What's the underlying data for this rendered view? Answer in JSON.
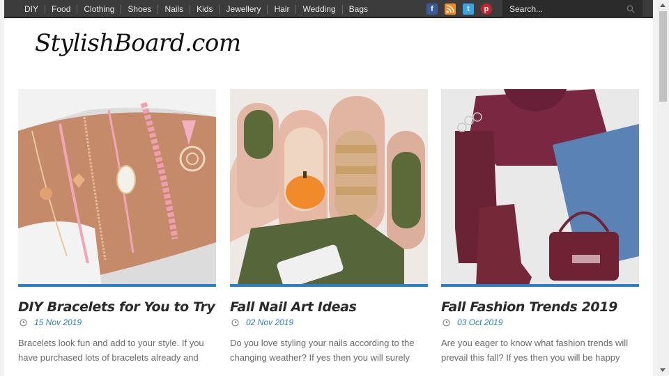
{
  "nav": {
    "items": [
      "DIY",
      "Food",
      "Clothing",
      "Shoes",
      "Nails",
      "Kids",
      "Jewellery",
      "Hair",
      "Wedding",
      "Bags"
    ]
  },
  "social": {
    "icons": [
      "facebook-icon",
      "rss-icon",
      "twitter-icon",
      "pinterest-icon"
    ],
    "glyphs": [
      "f",
      "◢",
      "t",
      "p"
    ]
  },
  "search": {
    "placeholder": "Search..."
  },
  "site": {
    "logo": "StylishBoard.com"
  },
  "posts": [
    {
      "title": "DIY Bracelets for You to Try",
      "date": "15 Nov 2019",
      "excerpt": "Bracelets look fun and add to your style. If you have purchased lots of bracelets already and",
      "image": "bracelets-on-wrist"
    },
    {
      "title": "Fall Nail Art Ideas",
      "date": "02 Nov 2019",
      "excerpt": "Do you love styling your nails according to the changing weather? If yes then you will surely",
      "image": "green-fall-nails-with-pumpkin"
    },
    {
      "title": "Fall Fashion Trends 2019",
      "date": "03 Oct 2019",
      "excerpt": "Are you eager to know what fashion trends will prevail this fall? If yes then you will be happy",
      "image": "burgundy-sweater-boots-bag-flatlay"
    }
  ],
  "colors": {
    "accent": "#2a7ec6",
    "topbar": "#3c3c3c"
  }
}
